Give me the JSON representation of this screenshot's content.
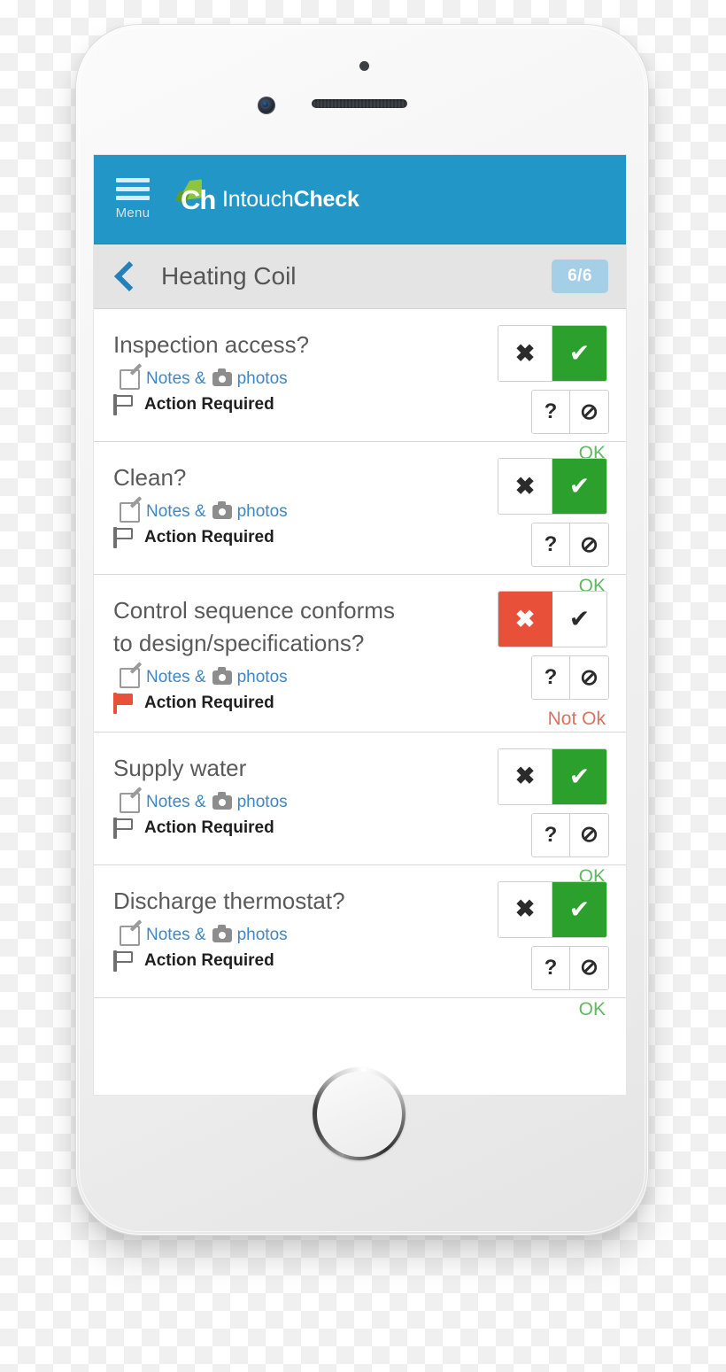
{
  "app": {
    "menu_label": "Menu",
    "logo_text": "Ch",
    "brand_light": "Intouch",
    "brand_bold": "Check",
    "header_color": "#2196c7",
    "logo_green": "#8cc63f"
  },
  "title_bar": {
    "back_icon": "chevron-left-icon",
    "title": "Heating Coil",
    "progress_badge": "6/6",
    "badge_color": "#a5cfe6"
  },
  "labels": {
    "notes_text": "Notes &",
    "photos_text": "photos",
    "action_required": "Action Required",
    "edit_icon": "edit-pencil-icon",
    "camera_icon": "camera-icon",
    "flag_icon": "flag-icon"
  },
  "buttons": {
    "no": "✖",
    "yes": "✔",
    "unsure": "?",
    "not_applicable": "⊘",
    "selected_yes_color": "#2ca02c",
    "selected_no_color": "#e8503a"
  },
  "status": {
    "ok": "OK",
    "not_ok": "Not Ok",
    "ok_color": "#63b863",
    "not_ok_color": "#d9735f"
  },
  "checklist": {
    "items": [
      {
        "question": "Inspection access?",
        "answer": "yes",
        "status": "OK",
        "flagged": false
      },
      {
        "question": "Clean?",
        "answer": "yes",
        "status": "OK",
        "flagged": false
      },
      {
        "question": "Control sequence conforms to design/specifications?",
        "answer": "no",
        "status": "Not Ok",
        "flagged": true
      },
      {
        "question": "Supply water",
        "answer": "yes",
        "status": "OK",
        "flagged": false
      },
      {
        "question": "Discharge thermostat?",
        "answer": "yes",
        "status": "OK",
        "flagged": false
      }
    ]
  },
  "device": {
    "camera_icon": "front-camera-icon",
    "speaker_icon": "earpiece-speaker-icon",
    "sensor_icon": "proximity-sensor-icon",
    "home_icon": "home-button-icon"
  }
}
